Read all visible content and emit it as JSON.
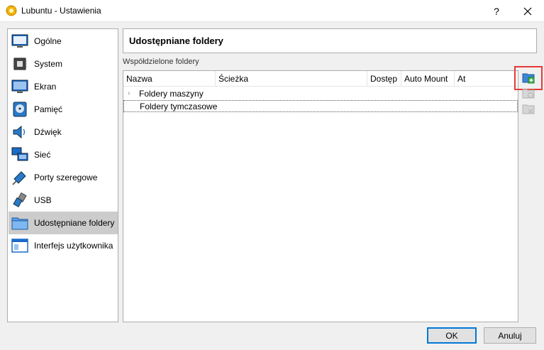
{
  "window": {
    "title": "Lubuntu - Ustawienia",
    "help_label": "?",
    "close_label": "×"
  },
  "nav": {
    "items": [
      {
        "label": "Ogólne",
        "icon": "general-icon"
      },
      {
        "label": "System",
        "icon": "system-icon"
      },
      {
        "label": "Ekran",
        "icon": "display-icon"
      },
      {
        "label": "Pamięć",
        "icon": "storage-icon"
      },
      {
        "label": "Dźwięk",
        "icon": "audio-icon"
      },
      {
        "label": "Sieć",
        "icon": "network-icon"
      },
      {
        "label": "Porty szeregowe",
        "icon": "serial-ports-icon"
      },
      {
        "label": "USB",
        "icon": "usb-icon"
      },
      {
        "label": "Udostępniane foldery",
        "icon": "shared-folders-icon"
      },
      {
        "label": "Interfejs użytkownika",
        "icon": "user-interface-icon"
      }
    ],
    "selected_index": 8
  },
  "page": {
    "title": "Udostępniane foldery",
    "group_label": "Współdzielone foldery"
  },
  "table": {
    "columns": [
      "Nazwa",
      "Ścieżka",
      "Dostęp",
      "Auto Mount",
      "At"
    ],
    "rows": [
      {
        "label": "Foldery maszyny",
        "expander": "›"
      },
      {
        "label": "Foldery tymczasowe",
        "expander": ""
      }
    ]
  },
  "tools": {
    "add_icon": "add-shared-folder-icon",
    "edit_icon": "edit-shared-folder-icon",
    "remove_icon": "remove-shared-folder-icon"
  },
  "buttons": {
    "ok": "OK",
    "cancel": "Anuluj"
  },
  "colors": {
    "selection": "#cccccc",
    "highlight": "#e53935",
    "accent": "#0078d7"
  }
}
